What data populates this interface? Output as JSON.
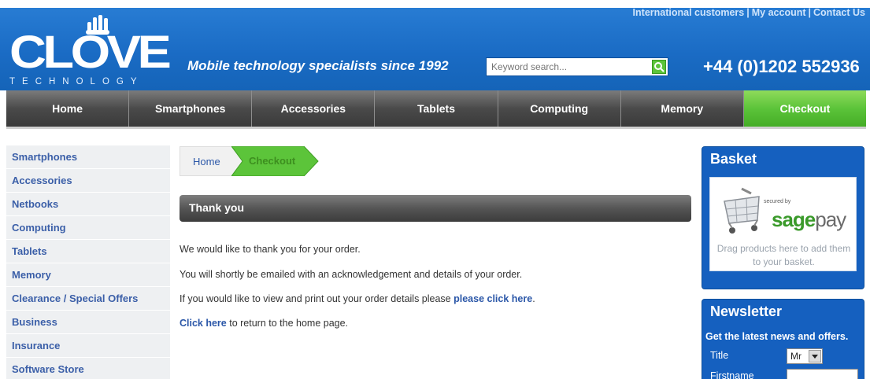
{
  "header": {
    "top_links": [
      "International customers",
      "My account",
      "Contact Us"
    ],
    "logo_text": "CLOVE",
    "logo_sub": "TECHNOLOGY",
    "tagline": "Mobile technology specialists since 1992",
    "search_placeholder": "Keyword search...",
    "phone": "+44 (0)1202 552936",
    "brand_blue": "#1a6bc4"
  },
  "nav": {
    "items": [
      "Home",
      "Smartphones",
      "Accessories",
      "Tablets",
      "Computing",
      "Memory",
      "Checkout"
    ],
    "checkout_color": "#5cc43a"
  },
  "sidebar": {
    "items": [
      "Smartphones",
      "Accessories",
      "Netbooks",
      "Computing",
      "Tablets",
      "Memory",
      "Clearance / Special Offers",
      "Business",
      "Insurance",
      "Software Store"
    ]
  },
  "breadcrumb": {
    "home": "Home",
    "current": "Checkout"
  },
  "main": {
    "heading": "Thank you",
    "line1": "We would like to thank you for your order.",
    "line2": "You will shortly be emailed with an acknowledgement and details of your order.",
    "line3_prefix": "If you would like to view and print out your order details please ",
    "line3_link": "please click here",
    "line3_suffix": ".",
    "line4_link": "Click here",
    "line4_suffix": " to return to the home page."
  },
  "basket": {
    "title": "Basket",
    "secured_by": "secured by",
    "sage": "sage",
    "pay": "pay",
    "drag_text": "Drag products here to add them to your basket."
  },
  "newsletter": {
    "title": "Newsletter",
    "subtitle": "Get the latest news and offers.",
    "title_label": "Title",
    "title_value": "Mr",
    "firstname_label": "Firstname"
  }
}
